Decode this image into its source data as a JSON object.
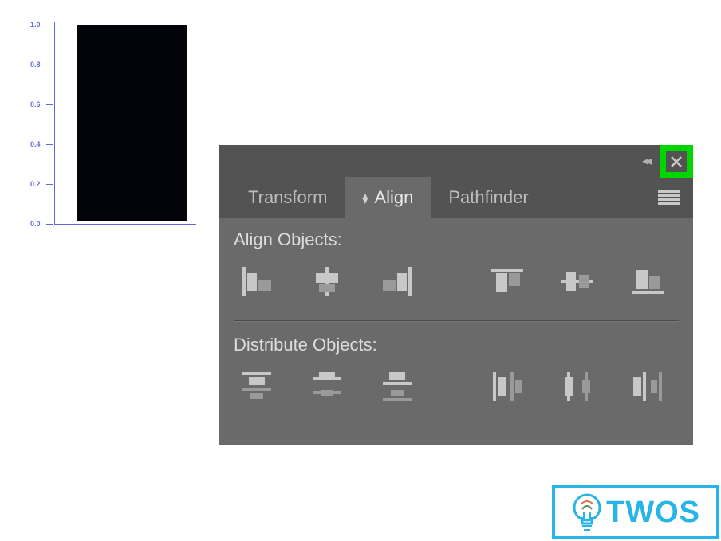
{
  "artboard": {
    "ticks": [
      "1.0",
      "0.8",
      "0.6",
      "0.4",
      "0.2",
      "0.0"
    ]
  },
  "panel": {
    "tabs": {
      "transform": "Transform",
      "align": "Align",
      "pathfinder": "Pathfinder"
    },
    "sections": {
      "align_objects": "Align Objects:",
      "distribute_objects": "Distribute Objects:"
    },
    "icons": {
      "align_left": "align-left",
      "align_hcenter": "align-horizontal-center",
      "align_right": "align-right",
      "align_top": "align-top",
      "align_vcenter": "align-vertical-center",
      "align_bottom": "align-bottom",
      "dist_top": "distribute-top",
      "dist_vcenter": "distribute-vertical-center",
      "dist_bottom": "distribute-bottom",
      "dist_left": "distribute-left",
      "dist_hcenter": "distribute-horizontal-center",
      "dist_right": "distribute-right"
    }
  },
  "logo": {
    "text": "TWOS"
  }
}
